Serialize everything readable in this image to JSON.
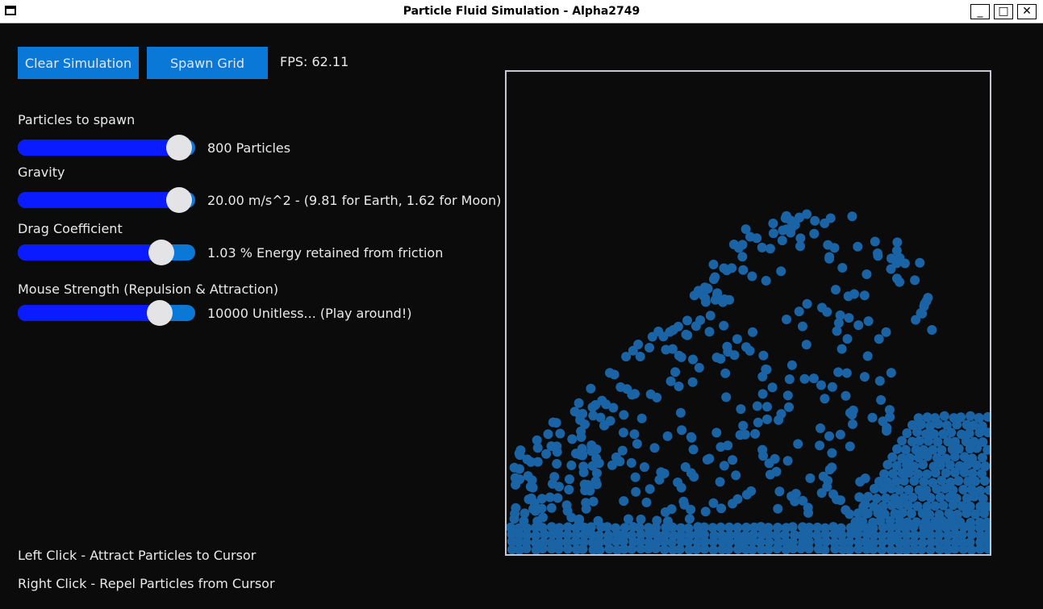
{
  "window": {
    "title": "Particle Fluid Simulation - Alpha2749",
    "minimize_glyph": "_",
    "maximize_glyph": "□",
    "close_glyph": "✕"
  },
  "toolbar": {
    "clear_label": "Clear Simulation",
    "spawn_label": "Spawn Grid",
    "fps_text": "FPS: 62.11"
  },
  "controls": {
    "particles": {
      "label": "Particles to spawn",
      "value_text": "800 Particles",
      "level": 1.0
    },
    "gravity": {
      "label": "Gravity",
      "value_text": "20.00 m/s^2 - (9.81 for Earth, 1.62 for Moon)",
      "level": 1.0
    },
    "drag": {
      "label": "Drag Coefficient",
      "value_text": "1.03 % Energy retained from friction",
      "level": 0.81
    },
    "mouse": {
      "label": "Mouse Strength (Repulsion & Attraction)",
      "value_text": "10000 Unitless... (Play around!)",
      "level": 0.8
    }
  },
  "help": {
    "left_click": "Left Click - Attract Particles to Cursor",
    "right_click": "Right Click - Repel Particles from Cursor"
  },
  "colors": {
    "background": "#0b0b0c",
    "button": "#0a78d7",
    "slider_fill": "#0a1cff",
    "particle": "#1a64a6",
    "border": "#c8c8d4"
  }
}
